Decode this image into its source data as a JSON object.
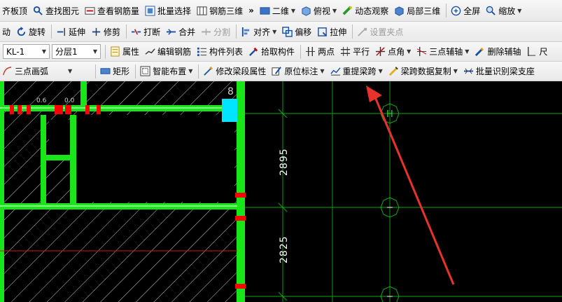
{
  "toolbar1": {
    "items": [
      {
        "label": "齐板顶",
        "icon": "slab-top-icon"
      },
      {
        "label": "查找图元",
        "icon": "find-element-icon"
      },
      {
        "label": "查看钢筋量",
        "icon": "rebar-quantity-icon"
      },
      {
        "label": "批量选择",
        "icon": "batch-select-icon"
      },
      {
        "label": "钢筋三维",
        "icon": "rebar-3d-icon"
      },
      {
        "label": "»",
        "icon": "more-icon"
      },
      {
        "label": "二维",
        "icon": "2d-view-icon"
      },
      {
        "label": "俯视",
        "icon": "top-view-icon"
      },
      {
        "label": "动态观察",
        "icon": "orbit-icon"
      },
      {
        "label": "局部三维",
        "icon": "local-3d-icon"
      },
      {
        "label": "全屏",
        "icon": "fullscreen-icon"
      },
      {
        "label": "缩放",
        "icon": "zoom-icon"
      }
    ]
  },
  "toolbar2": {
    "items": [
      {
        "label": "动",
        "icon": ""
      },
      {
        "label": "旋转",
        "icon": "rotate-icon"
      },
      {
        "label": "延伸",
        "icon": "extend-icon"
      },
      {
        "label": "修剪",
        "icon": "trim-icon"
      },
      {
        "label": "打断",
        "icon": "break-icon"
      },
      {
        "label": "合并",
        "icon": "merge-icon"
      },
      {
        "label": "分割",
        "icon": "split-icon"
      },
      {
        "label": "对齐",
        "icon": "align-icon"
      },
      {
        "label": "偏移",
        "icon": "offset-icon"
      },
      {
        "label": "拉伸",
        "icon": "stretch-icon"
      },
      {
        "label": "设置夹点",
        "icon": "grip-icon"
      }
    ]
  },
  "toolbar3": {
    "element_value": "KL-1",
    "floor_value": "分层1",
    "items": [
      {
        "label": "属性",
        "icon": "properties-icon"
      },
      {
        "label": "编辑钢筋",
        "icon": "edit-rebar-icon"
      },
      {
        "label": "构件列表",
        "icon": "component-list-icon"
      },
      {
        "label": "拾取构件",
        "icon": "pick-component-icon"
      },
      {
        "label": "两点",
        "icon": "two-point-icon"
      },
      {
        "label": "平行",
        "icon": "parallel-icon"
      },
      {
        "label": "点角",
        "icon": "point-angle-icon"
      },
      {
        "label": "三点辅轴",
        "icon": "three-point-axis-icon"
      },
      {
        "label": "删除辅轴",
        "icon": "delete-axis-icon"
      },
      {
        "label": "尺",
        "icon": "ruler-icon"
      }
    ]
  },
  "toolbar4": {
    "items": [
      {
        "label": "三点画弧",
        "icon": "arc-icon"
      },
      {
        "label": "矩形",
        "icon": "rectangle-icon"
      },
      {
        "label": "智能布置",
        "icon": "smart-layout-icon"
      },
      {
        "label": "修改梁段属性",
        "icon": "modify-segment-icon"
      },
      {
        "label": "原位标注",
        "icon": "in-situ-annotation-icon"
      },
      {
        "label": "重提梁跨",
        "icon": "re-extract-span-icon"
      },
      {
        "label": "梁跨数据复制",
        "icon": "copy-span-data-icon"
      },
      {
        "label": "批量识别梁支座",
        "icon": "identify-supports-icon"
      }
    ]
  },
  "drawing": {
    "dim1": "2895",
    "dim2": "2825",
    "axis_label": "H",
    "axis_label_small": "8",
    "beam_text_1": "0.6",
    "beam_text_2": "0.0"
  },
  "colors": {
    "canvas": "#000000",
    "beam": "#19e619",
    "axis": "#11a811",
    "support": "#ff0000",
    "column": "#00e5ff",
    "dim_line": "#0f9a0f",
    "arrow": "#e8322c"
  }
}
